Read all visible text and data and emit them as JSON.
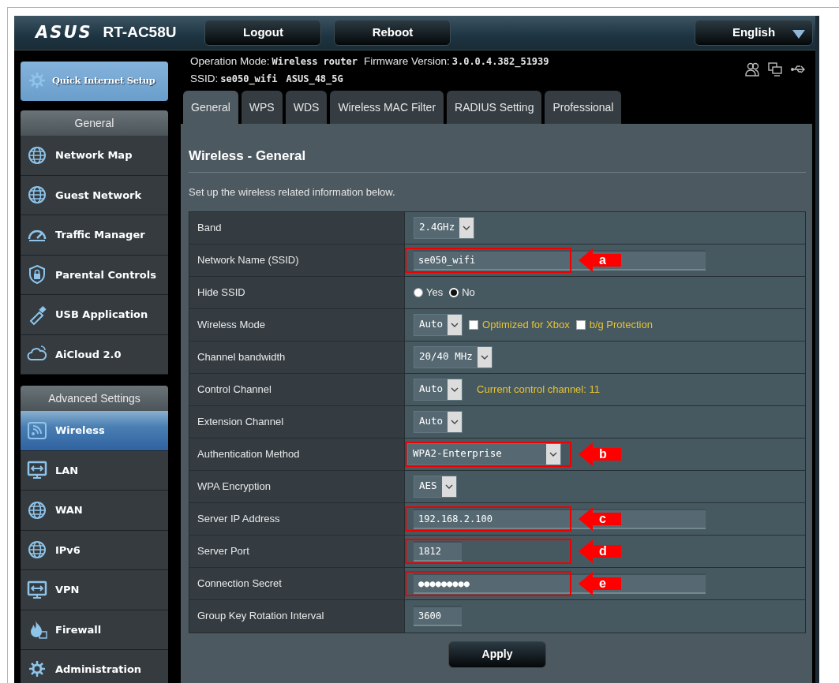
{
  "header": {
    "logo": "ASUS",
    "model": "RT-AC58U",
    "buttons": [
      "Logout",
      "Reboot"
    ],
    "language": "English"
  },
  "sidebar": {
    "quick_setup": "Quick Internet Setup",
    "sections": [
      {
        "title": "General",
        "items": [
          {
            "label": "Network Map",
            "selected": false
          },
          {
            "label": "Guest Network",
            "selected": false
          },
          {
            "label": "Traffic Manager",
            "selected": false
          },
          {
            "label": "Parental Controls",
            "selected": false
          },
          {
            "label": "USB Application",
            "selected": false
          },
          {
            "label": "AiCloud 2.0",
            "selected": false
          }
        ]
      },
      {
        "title": "Advanced Settings",
        "items": [
          {
            "label": "Wireless",
            "selected": true
          },
          {
            "label": "LAN",
            "selected": false
          },
          {
            "label": "WAN",
            "selected": false
          },
          {
            "label": "IPv6",
            "selected": false
          },
          {
            "label": "VPN",
            "selected": false
          },
          {
            "label": "Firewall",
            "selected": false
          },
          {
            "label": "Administration",
            "selected": false
          }
        ]
      }
    ]
  },
  "status": {
    "operation_mode_label": "Operation Mode:",
    "operation_mode": "Wireless router",
    "firmware_label": "Firmware Version:",
    "firmware": "3.0.0.4.382_51939",
    "ssid_label": "SSID:",
    "ssids": [
      "se050_wifi",
      "ASUS_48_5G"
    ]
  },
  "tabs": [
    {
      "label": "General",
      "selected": true
    },
    {
      "label": "WPS",
      "selected": false
    },
    {
      "label": "WDS",
      "selected": false
    },
    {
      "label": "Wireless MAC Filter",
      "selected": false
    },
    {
      "label": "RADIUS Setting",
      "selected": false
    },
    {
      "label": "Professional",
      "selected": false
    }
  ],
  "page": {
    "title": "Wireless - General",
    "description": "Set up the wireless related information below.",
    "rows": [
      {
        "label": "Band",
        "kind": "select",
        "value": "2.4GHz"
      },
      {
        "label": "Network Name (SSID)",
        "kind": "text",
        "value": "se050_wifi",
        "callout": "a"
      },
      {
        "label": "Hide SSID",
        "kind": "radio",
        "options": [
          {
            "label": "Yes",
            "selected": false
          },
          {
            "label": "No",
            "selected": true
          }
        ]
      },
      {
        "label": "Wireless Mode",
        "kind": "select",
        "value": "Auto",
        "checkboxes": [
          {
            "label": "Optimized for Xbox",
            "checked": false
          },
          {
            "label": "b/g Protection",
            "checked": false
          }
        ]
      },
      {
        "label": "Channel bandwidth",
        "kind": "select",
        "value": "20/40 MHz"
      },
      {
        "label": "Control Channel",
        "kind": "select",
        "value": "Auto",
        "note": "Current control channel: 11"
      },
      {
        "label": "Extension Channel",
        "kind": "select",
        "value": "Auto"
      },
      {
        "label": "Authentication Method",
        "kind": "select",
        "value": "WPA2-Enterprise",
        "callout": "b"
      },
      {
        "label": "WPA Encryption",
        "kind": "select",
        "value": "AES"
      },
      {
        "label": "Server IP Address",
        "kind": "text",
        "value": "192.168.2.100",
        "callout": "c"
      },
      {
        "label": "Server Port",
        "kind": "short_text",
        "value": "1812",
        "callout": "d"
      },
      {
        "label": "Connection Secret",
        "kind": "text",
        "value": "●●●●●●●●●",
        "callout": "e"
      },
      {
        "label": "Group Key Rotation Interval",
        "kind": "short_text",
        "value": "3600"
      }
    ],
    "apply": "Apply"
  }
}
